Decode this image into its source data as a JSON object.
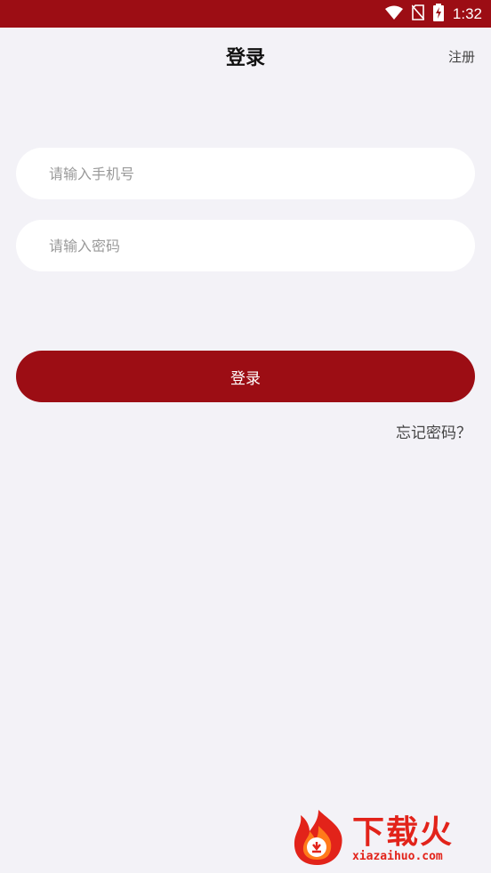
{
  "status_bar": {
    "time": "1:32",
    "icons": [
      "wifi-icon",
      "no-sim-icon",
      "battery-charging-icon"
    ]
  },
  "header": {
    "title": "登录",
    "register": "注册"
  },
  "form": {
    "phone_placeholder": "请输入手机号",
    "password_placeholder": "请输入密码",
    "login_label": "登录",
    "forgot_label": "忘记密码？"
  },
  "watermark": {
    "title": "下载火",
    "url": "xiazaihuo.com"
  },
  "colors": {
    "brand": "#9c0d14",
    "background": "#f3f2f7",
    "watermark": "#e2231a"
  }
}
